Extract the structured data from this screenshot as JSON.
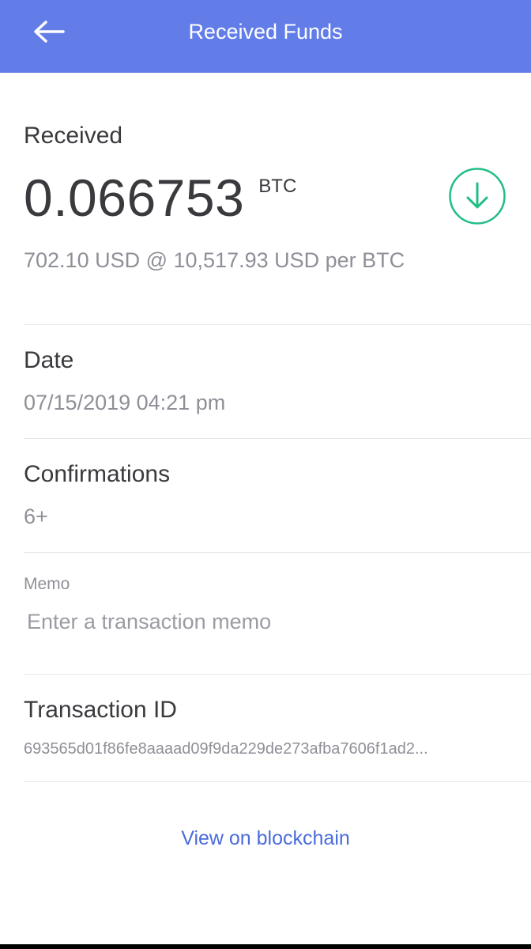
{
  "header": {
    "title": "Received Funds",
    "back_icon": "arrow-left-icon"
  },
  "received": {
    "label": "Received",
    "amount": "0.066753",
    "unit": "BTC",
    "fiat_line": "702.10 USD @ 10,517.93 USD per BTC",
    "icon": "arrow-down-circle-icon"
  },
  "date": {
    "label": "Date",
    "value": "07/15/2019 04:21 pm"
  },
  "confirmations": {
    "label": "Confirmations",
    "value": "6+"
  },
  "memo": {
    "label": "Memo",
    "value": "",
    "placeholder": "Enter a transaction memo"
  },
  "transaction": {
    "label": "Transaction ID",
    "value": "693565d01f86fe8aaaad09f9da229de273afba7606f1ad2..."
  },
  "actions": {
    "view_blockchain": "View on blockchain"
  },
  "colors": {
    "header_bg": "#637DE8",
    "accent_green": "#21BE85",
    "link": "#4A6BDC"
  }
}
